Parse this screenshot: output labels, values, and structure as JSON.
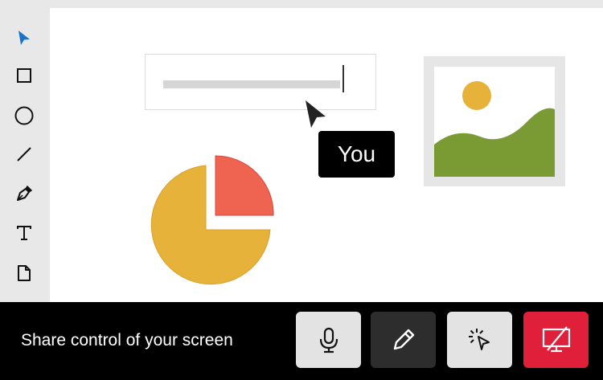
{
  "toolbar": {
    "tools": [
      {
        "name": "select-tool",
        "icon": "cursor-arrow-icon",
        "active": true,
        "color": "#1a73c7"
      },
      {
        "name": "rectangle-tool",
        "icon": "rectangle-icon"
      },
      {
        "name": "ellipse-tool",
        "icon": "circle-icon"
      },
      {
        "name": "line-tool",
        "icon": "line-icon"
      },
      {
        "name": "pen-tool",
        "icon": "pen-nib-icon"
      },
      {
        "name": "text-tool",
        "icon": "text-icon"
      },
      {
        "name": "page-tool",
        "icon": "page-icon"
      }
    ]
  },
  "canvas": {
    "collaborator_label": "You",
    "pie_colors": {
      "main": "#e6b23a",
      "slice": "#ee6450"
    },
    "image_colors": {
      "sun": "#e6b23a",
      "hill": "#7a9a34",
      "frame": "#e6e6e6"
    }
  },
  "bottom_bar": {
    "share_text": "Share control of your screen",
    "buttons": [
      {
        "name": "microphone-button",
        "icon": "microphone-icon",
        "style": "light"
      },
      {
        "name": "annotate-button",
        "icon": "pencil-icon",
        "style": "dark"
      },
      {
        "name": "remote-control-button",
        "icon": "click-pointer-icon",
        "style": "light"
      },
      {
        "name": "stop-sharing-button",
        "icon": "screen-off-icon",
        "style": "red"
      }
    ]
  },
  "colors": {
    "accent": "#1a73c7",
    "danger": "#e0203a",
    "bar_background": "#000000"
  }
}
